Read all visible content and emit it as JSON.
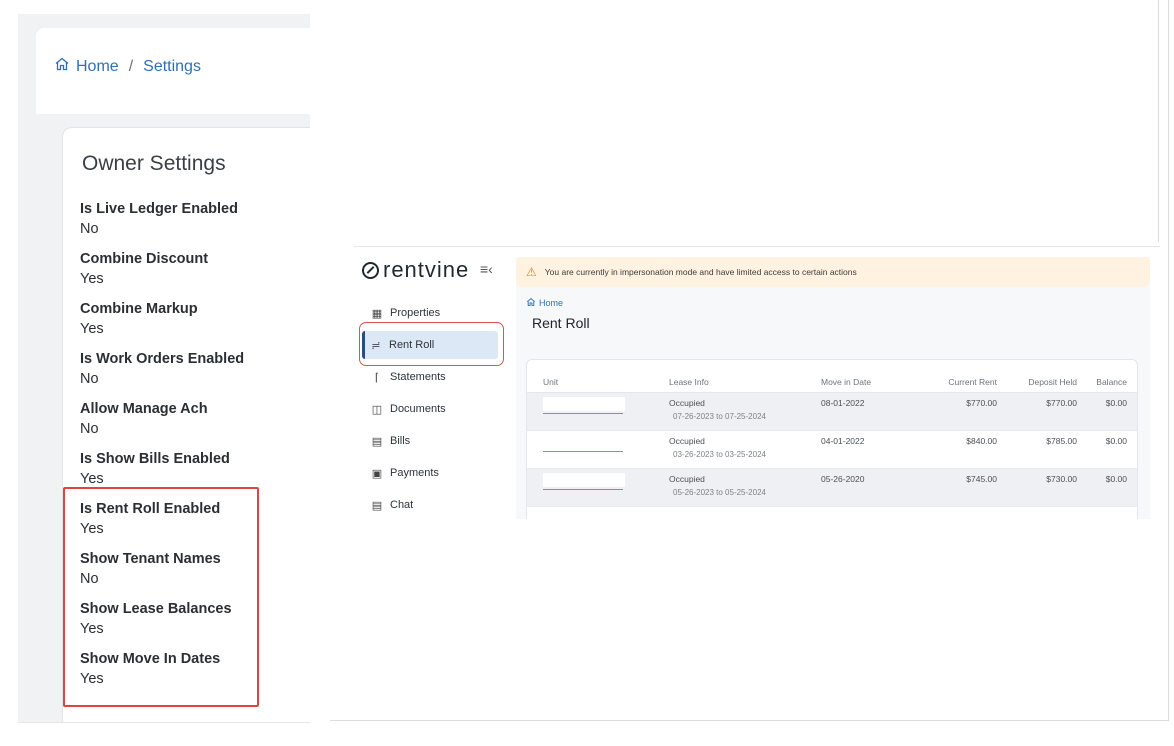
{
  "settings_page": {
    "breadcrumb": {
      "home": "Home",
      "separator": "/",
      "current": "Settings"
    },
    "card_title": "Owner Settings",
    "settings": [
      {
        "label": "Is Live Ledger Enabled",
        "value": "No"
      },
      {
        "label": "Combine Discount",
        "value": "Yes"
      },
      {
        "label": "Combine Markup",
        "value": "Yes"
      },
      {
        "label": "Is Work Orders Enabled",
        "value": "No"
      },
      {
        "label": "Allow Manage Ach",
        "value": "No"
      },
      {
        "label": "Is Show Bills Enabled",
        "value": "Yes"
      },
      {
        "label": "Is Rent Roll Enabled",
        "value": "Yes"
      },
      {
        "label": "Show Tenant Names",
        "value": "No"
      },
      {
        "label": "Show Lease Balances",
        "value": "Yes"
      },
      {
        "label": "Show Move In Dates",
        "value": "Yes"
      }
    ]
  },
  "rentvine": {
    "logo": "rentvine",
    "nav": [
      {
        "label": "Properties",
        "icon": "building-icon"
      },
      {
        "label": "Rent Roll",
        "icon": "chart-icon",
        "active": true
      },
      {
        "label": "Statements",
        "icon": "bank-icon"
      },
      {
        "label": "Documents",
        "icon": "archive-icon"
      },
      {
        "label": "Bills",
        "icon": "receipt-icon"
      },
      {
        "label": "Payments",
        "icon": "money-icon"
      },
      {
        "label": "Chat",
        "icon": "chat-icon"
      }
    ],
    "warning": "You are currently in impersonation mode and have limited access to certain actions",
    "breadcrumb_home": "Home",
    "page_title": "Rent Roll",
    "table": {
      "headers": [
        "Unit",
        "Lease Info",
        "Move in Date",
        "Current Rent",
        "Deposit Held",
        "Balance"
      ],
      "rows": [
        {
          "status": "Occupied",
          "term": "07-26-2023 to 07-25-2024",
          "move_in": "08-01-2022",
          "rent": "$770.00",
          "deposit": "$770.00",
          "balance": "$0.00"
        },
        {
          "status": "Occupied",
          "term": "03-26-2023 to 03-25-2024",
          "move_in": "04-01-2022",
          "rent": "$840.00",
          "deposit": "$785.00",
          "balance": "$0.00"
        },
        {
          "status": "Occupied",
          "term": "05-26-2023 to 05-25-2024",
          "move_in": "05-26-2020",
          "rent": "$745.00",
          "deposit": "$730.00",
          "balance": "$0.00"
        }
      ]
    }
  },
  "colors": {
    "link": "#2f6fb6",
    "highlight": "#e0443a",
    "warning_bg": "#fff2e0",
    "active_nav": "#dde8f6"
  }
}
